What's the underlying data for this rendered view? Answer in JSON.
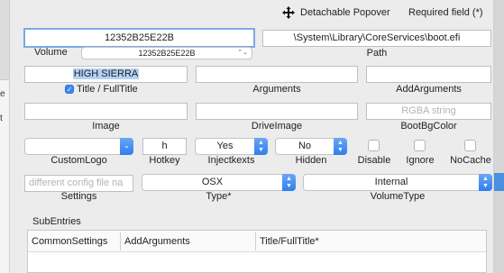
{
  "toolbar": {
    "detachable_label": "Detachable Popover",
    "required_label": "Required field (*)"
  },
  "volume": {
    "field_value": "12352B25E22B",
    "popup_value": "12352B25E22B",
    "label": "Volume"
  },
  "path": {
    "value": "\\System\\Library\\CoreServices\\boot.efi",
    "label": "Path"
  },
  "title": {
    "value": "HIGH SIERRA",
    "checkbox_checked": true,
    "label": "Title / FullTitle"
  },
  "arguments": {
    "value": "",
    "label": "Arguments"
  },
  "add_arguments": {
    "value": "",
    "label": "AddArguments"
  },
  "image": {
    "value": "",
    "label": "Image"
  },
  "drive_image": {
    "value": "",
    "label": "DriveImage"
  },
  "boot_bg_color": {
    "placeholder": "RGBA string",
    "label": "BootBgColor"
  },
  "custom_logo": {
    "value": "",
    "label": "CustomLogo"
  },
  "hotkey": {
    "value": "h",
    "label": "Hotkey"
  },
  "inject_kexts": {
    "value": "Yes",
    "label": "Injectkexts"
  },
  "hidden": {
    "value": "No",
    "label": "Hidden"
  },
  "disable": {
    "checked": false,
    "label": "Disable"
  },
  "ignore": {
    "checked": false,
    "label": "Ignore"
  },
  "nocache": {
    "checked": false,
    "label": "NoCache"
  },
  "settings": {
    "placeholder": "different config file na",
    "label": "Settings"
  },
  "type": {
    "value": "OSX",
    "label": "Type*"
  },
  "volume_type": {
    "value": "Internal",
    "label": "VolumeType"
  },
  "subentries": {
    "label": "SubEntries",
    "columns": [
      "CommonSettings",
      "AddArguments",
      "Title/FullTitle*"
    ]
  },
  "background": {
    "left_ticks": [
      "e",
      "t"
    ]
  },
  "colors": {
    "accent": "#3b86f2",
    "focus_ring": "#7aa9e6",
    "selection": "#b3d1f5"
  }
}
